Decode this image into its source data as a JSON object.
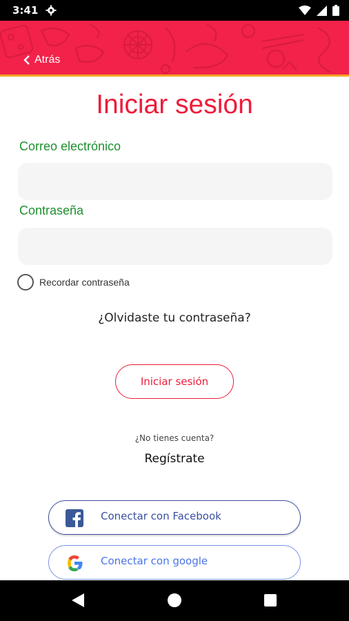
{
  "status_bar": {
    "time": "3:41",
    "icons": [
      "gear-icon",
      "wifi-icon",
      "signal-icon",
      "battery-icon"
    ]
  },
  "header": {
    "back_label": "Atrás",
    "background_color": "#f2224a",
    "stripe_color": "#f3a51f"
  },
  "page": {
    "title": "Iniciar sesión"
  },
  "form": {
    "email_label": "Correo electrónico",
    "email_value": "",
    "password_label": "Contraseña",
    "password_value": "",
    "remember_label": "Recordar contraseña",
    "remember_checked": false,
    "forgot_label": "¿Olvidaste tu contraseña?",
    "login_button": "Iniciar sesión"
  },
  "signup": {
    "prompt": "¿No tienes cuenta?",
    "register_label": "Regístrate"
  },
  "social": {
    "facebook_label": "Conectar con Facebook",
    "google_label": "Conectar con google"
  },
  "colors": {
    "accent": "#ee1c3a",
    "label_green": "#1f8f2f",
    "social_blue": "#3b4fa0"
  }
}
